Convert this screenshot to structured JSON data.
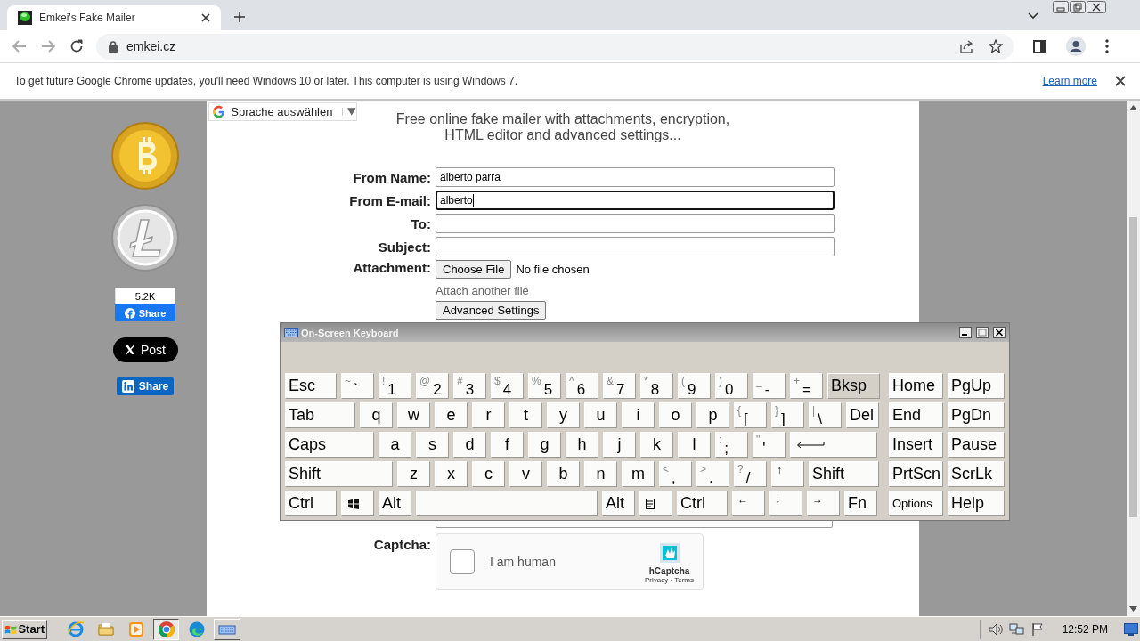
{
  "browser": {
    "tabs": [
      {
        "title": "Emkei's Fake Mailer",
        "selected": true
      }
    ],
    "url": "emkei.cz",
    "infobar": {
      "message": "To get future Google Chrome updates, you'll need Windows 10 or later. This computer is using Windows 7.",
      "link": "Learn more"
    }
  },
  "page": {
    "translate": {
      "label": "Sprache auswählen"
    },
    "headline": "Free online fake mailer with attachments, encryption, HTML editor and advanced settings...",
    "share": {
      "facebook_count": "5.2K",
      "facebook_label": "Share",
      "x_label": "Post",
      "linkedin_label": "Share"
    },
    "form": {
      "fields": [
        {
          "label": "From Name:",
          "value": "alberto parra",
          "focused": false
        },
        {
          "label": "From E-mail:",
          "value": "alberto",
          "focused": true
        },
        {
          "label": "To:",
          "focused": false
        },
        {
          "label": "Subject:",
          "focused": false
        }
      ],
      "attachment": {
        "label": "Attachment:",
        "button": "Choose File",
        "status": "No file chosen"
      },
      "attach_another": "Attach another file",
      "advanced_button": "Advanced Settings",
      "captcha": {
        "label": "Captcha:",
        "checkbox_label": "I am human",
        "checked": false,
        "brand": "hCaptcha",
        "links": "Privacy - Terms"
      }
    }
  },
  "keyboard": {
    "title": "On-Screen Keyboard",
    "rows": [
      {
        "keys": [
          {
            "kind": "label",
            "text": "Esc",
            "hover": false
          },
          {
            "kind": "char",
            "shift": "~",
            "main": "`",
            "hover": false
          },
          {
            "kind": "char",
            "shift": "!",
            "main": "1",
            "hover": false
          },
          {
            "kind": "char",
            "shift": "@",
            "main": "2",
            "hover": false
          },
          {
            "kind": "char",
            "shift": "#",
            "main": "3",
            "hover": false
          },
          {
            "kind": "char",
            "shift": "$",
            "main": "4",
            "hover": false
          },
          {
            "kind": "char",
            "shift": "%",
            "main": "5",
            "hover": false
          },
          {
            "kind": "char",
            "shift": "^",
            "main": "6",
            "hover": false
          },
          {
            "kind": "char",
            "shift": "&",
            "main": "7",
            "hover": false
          },
          {
            "kind": "char",
            "shift": "*",
            "main": "8",
            "hover": false
          },
          {
            "kind": "char",
            "shift": "(",
            "main": "9",
            "hover": false
          },
          {
            "kind": "char",
            "shift": ")",
            "main": "0",
            "hover": false
          },
          {
            "kind": "char",
            "shift": "_",
            "main": "-",
            "hover": false
          },
          {
            "kind": "char",
            "shift": "+",
            "main": "=",
            "hover": false
          },
          {
            "kind": "label",
            "text": "Bksp",
            "hover": true
          }
        ]
      },
      {
        "keys": [
          {
            "kind": "label",
            "text": "Tab",
            "hover": false
          },
          {
            "kind": "letter",
            "text": "q",
            "hover": false
          },
          {
            "kind": "letter",
            "text": "w",
            "hover": false
          },
          {
            "kind": "letter",
            "text": "e",
            "hover": false
          },
          {
            "kind": "letter",
            "text": "r",
            "hover": false
          },
          {
            "kind": "letter",
            "text": "t",
            "hover": false
          },
          {
            "kind": "letter",
            "text": "y",
            "hover": false
          },
          {
            "kind": "letter",
            "text": "u",
            "hover": false
          },
          {
            "kind": "letter",
            "text": "i",
            "hover": false
          },
          {
            "kind": "letter",
            "text": "o",
            "hover": false
          },
          {
            "kind": "letter",
            "text": "p",
            "hover": false
          },
          {
            "kind": "char",
            "shift": "{",
            "main": "[",
            "hover": false
          },
          {
            "kind": "char",
            "shift": "}",
            "main": "]",
            "hover": false
          },
          {
            "kind": "char",
            "shift": "|",
            "main": "\\",
            "hover": false
          },
          {
            "kind": "label",
            "text": "Del",
            "hover": false
          }
        ]
      },
      {
        "keys": [
          {
            "kind": "label",
            "text": "Caps",
            "hover": false
          },
          {
            "kind": "letter",
            "text": "a",
            "hover": false
          },
          {
            "kind": "letter",
            "text": "s",
            "hover": false
          },
          {
            "kind": "letter",
            "text": "d",
            "hover": false
          },
          {
            "kind": "letter",
            "text": "f",
            "hover": false
          },
          {
            "kind": "letter",
            "text": "g",
            "hover": false
          },
          {
            "kind": "letter",
            "text": "h",
            "hover": false
          },
          {
            "kind": "letter",
            "text": "j",
            "hover": false
          },
          {
            "kind": "letter",
            "text": "k",
            "hover": false
          },
          {
            "kind": "letter",
            "text": "l",
            "hover": false
          },
          {
            "kind": "char",
            "shift": ":",
            "main": ";",
            "hover": false
          },
          {
            "kind": "char",
            "shift": "\"",
            "main": "'",
            "hover": false
          },
          {
            "kind": "enter",
            "hover": false
          }
        ]
      },
      {
        "keys": [
          {
            "kind": "label",
            "text": "Shift",
            "hover": false
          },
          {
            "kind": "letter",
            "text": "z",
            "hover": false
          },
          {
            "kind": "letter",
            "text": "x",
            "hover": false
          },
          {
            "kind": "letter",
            "text": "c",
            "hover": false
          },
          {
            "kind": "letter",
            "text": "v",
            "hover": false
          },
          {
            "kind": "letter",
            "text": "b",
            "hover": false
          },
          {
            "kind": "letter",
            "text": "n",
            "hover": false
          },
          {
            "kind": "letter",
            "text": "m",
            "hover": false
          },
          {
            "kind": "char",
            "shift": "<",
            "main": ",",
            "hover": false
          },
          {
            "kind": "char",
            "shift": ">",
            "main": ".",
            "hover": false
          },
          {
            "kind": "char",
            "shift": "?",
            "main": "/",
            "hover": false
          },
          {
            "kind": "arrow",
            "text": "↑",
            "hover": false
          },
          {
            "kind": "label",
            "text": "Shift",
            "hover": false
          }
        ]
      },
      {
        "keys": [
          {
            "kind": "label",
            "text": "Ctrl",
            "hover": false
          },
          {
            "kind": "winkey",
            "hover": false
          },
          {
            "kind": "label",
            "text": "Alt",
            "hover": false
          },
          {
            "kind": "space",
            "hover": false
          },
          {
            "kind": "label",
            "text": "Alt",
            "hover": false
          },
          {
            "kind": "menukey",
            "hover": false
          },
          {
            "kind": "label",
            "text": "Ctrl",
            "hover": false
          },
          {
            "kind": "arrow",
            "text": "←",
            "hover": false
          },
          {
            "kind": "arrow",
            "text": "↓",
            "hover": false
          },
          {
            "kind": "arrow",
            "text": "→",
            "hover": false
          },
          {
            "kind": "label",
            "text": "Fn",
            "hover": false
          }
        ]
      }
    ],
    "nav": [
      {
        "kind": "label",
        "text": "Home",
        "hover": false
      },
      {
        "kind": "label",
        "text": "PgUp",
        "hover": false
      },
      {
        "kind": "label",
        "text": "End",
        "hover": false
      },
      {
        "kind": "label",
        "text": "PgDn",
        "hover": false
      },
      {
        "kind": "label",
        "text": "Insert",
        "hover": false
      },
      {
        "kind": "label",
        "text": "Pause",
        "hover": false
      },
      {
        "kind": "label",
        "text": "PrtScn",
        "hover": false
      },
      {
        "kind": "label",
        "text": "ScrLk",
        "hover": false
      },
      {
        "kind": "small",
        "text": "Options",
        "hover": false
      },
      {
        "kind": "label",
        "text": "Help",
        "hover": false
      }
    ]
  },
  "taskbar": {
    "start": "Start",
    "apps": [
      {
        "kind": "ie",
        "selected": false
      },
      {
        "kind": "folder",
        "selected": false
      },
      {
        "kind": "media",
        "selected": false
      },
      {
        "kind": "chrome",
        "selected": true
      },
      {
        "kind": "edge",
        "selected": false
      },
      {
        "kind": "keyboard",
        "selected": false
      }
    ],
    "clock": "12:52 PM"
  }
}
